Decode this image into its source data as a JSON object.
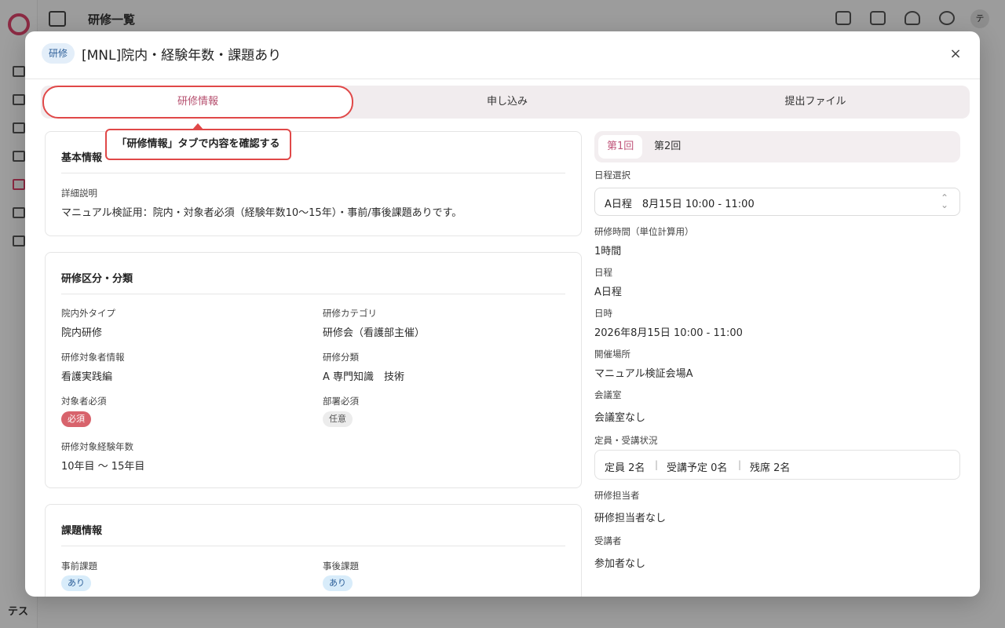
{
  "background": {
    "page_title": "研修一覧",
    "footer_text": "テス",
    "avatar_initial": "テ"
  },
  "modal": {
    "type_badge": "研修",
    "title": "[MNL]院内・経験年数・課題あり",
    "close_glyph": "×"
  },
  "tabs": [
    {
      "label": "研修情報",
      "active": true
    },
    {
      "label": "申し込み",
      "active": false
    },
    {
      "label": "提出ファイル",
      "active": false
    }
  ],
  "callout": "「研修情報」タブで内容を確認する",
  "basic_info": {
    "title": "基本情報",
    "detail_label": "詳細説明",
    "detail_value": "マニュアル検証用：院内・対象者必須（経験年数10〜15年）・事前/事後課題ありです。"
  },
  "classification": {
    "title": "研修区分・分類",
    "inout_label": "院内外タイプ",
    "inout_value": "院内研修",
    "category_label": "研修カテゴリ",
    "category_value": "研修会（看護部主催）",
    "target_label": "研修対象者情報",
    "target_value": "看護実践編",
    "division_label": "研修分類",
    "division_value": "A 専門知識　技術",
    "required_label": "対象者必須",
    "required_value": "必須",
    "dept_label": "部署必須",
    "dept_value": "任意",
    "years_label": "研修対象経験年数",
    "years_value": "10年目 〜 15年目"
  },
  "assignments": {
    "title": "課題情報",
    "pre_label": "事前課題",
    "pre_value": "あり",
    "post_label": "事後課題",
    "post_value": "あり"
  },
  "sessions": {
    "tabs": [
      {
        "label": "第1回",
        "active": true
      },
      {
        "label": "第2回",
        "active": false
      }
    ],
    "schedule_select_label": "日程選択",
    "schedule_select_value": "A日程　8月15日 10:00 - 11:00",
    "select_icon": "⌃⌄",
    "hours_label": "研修時間（単位計算用）",
    "hours_value": "1時間",
    "schedule_label": "日程",
    "schedule_value": "A日程",
    "datetime_label": "日時",
    "datetime_value": "2026年8月15日 10:00 - 11:00",
    "venue_label": "開催場所",
    "venue_value": "マニュアル検証会場A",
    "room_label": "会議室",
    "room_value": "会議室なし",
    "capacity_label": "定員・受講状況",
    "capacity": "定員 2名",
    "enrolled": "受講予定 0名",
    "remaining": "残席 2名",
    "separator": "|",
    "staff_label": "研修担当者",
    "staff_value": "研修担当者なし",
    "attendees_label": "受講者",
    "attendees_value": "参加者なし"
  }
}
